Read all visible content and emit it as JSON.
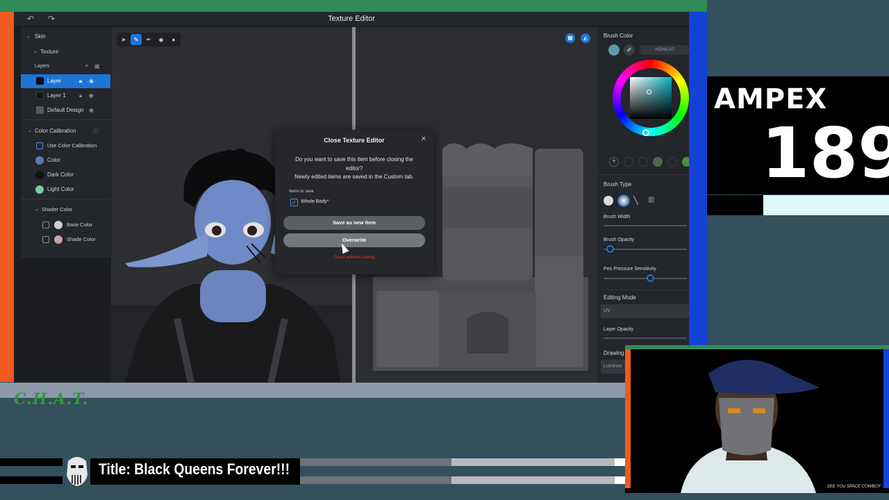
{
  "app": {
    "title": "Texture Editor"
  },
  "left_panel": {
    "skin": "Skin",
    "texture": "Texture",
    "layers_label": "Layers",
    "layers": [
      {
        "name": "Layer",
        "selected": true
      },
      {
        "name": "Layer 1",
        "selected": false
      },
      {
        "name": "Default Design",
        "selected": false
      }
    ],
    "color_calibration": "Color Calibration",
    "use_color_calibration": "Use Color Calibration",
    "color": "Color",
    "dark_color": "Dark Color",
    "light_color": "Light Color",
    "shader_color": "Shader Color",
    "base_color": "Base Color",
    "shade_color": "Shade Color",
    "colors": {
      "color": "#5a79b5",
      "dark": "#111111",
      "light": "#7ec9a2",
      "base": "#cfcfcf",
      "shade": "#caa3a3"
    }
  },
  "right_panel": {
    "brush_color": "Brush Color",
    "hex": "#5D9CA7",
    "brush_type": "Brush Type",
    "brush_width": "Brush Width",
    "brush_opacity": "Brush Opacity",
    "pen_pressure": "Pen Pressure Sensitivity",
    "editing_mode": "Editing Mode",
    "editing_mode_value": "UV",
    "layer_opacity": "Layer Opacity",
    "drawing_mode": "Drawing Mode",
    "drawing_mode_value": "Luminos",
    "brush_opacity_level": 0.1,
    "pen_pressure_level": 0.5
  },
  "dialog": {
    "title": "Close Texture Editor",
    "body_line1": "Do you want to save this item before closing the",
    "body_line2": "editor?",
    "body_line3": "Newly edited items are saved in the Custom tab.",
    "items_to_save": "Items to save",
    "item_label": "Whole Body*",
    "save_new": "Save as new item",
    "overwrite": "Overwrite",
    "close_without": "Close without saving"
  },
  "overlay": {
    "ampex": "AMPEX",
    "number": "189",
    "chat": "C.H.A.T.",
    "stream_title": "Title: Black Queens Forever!!!",
    "cam_caption": "SEE YOU SPACE COWBOY"
  },
  "colors": {
    "accent": "#1d74d6",
    "orange": "#f05a1e",
    "green": "#2e8b57",
    "blue": "#1542d6",
    "danger": "#e0372a"
  }
}
